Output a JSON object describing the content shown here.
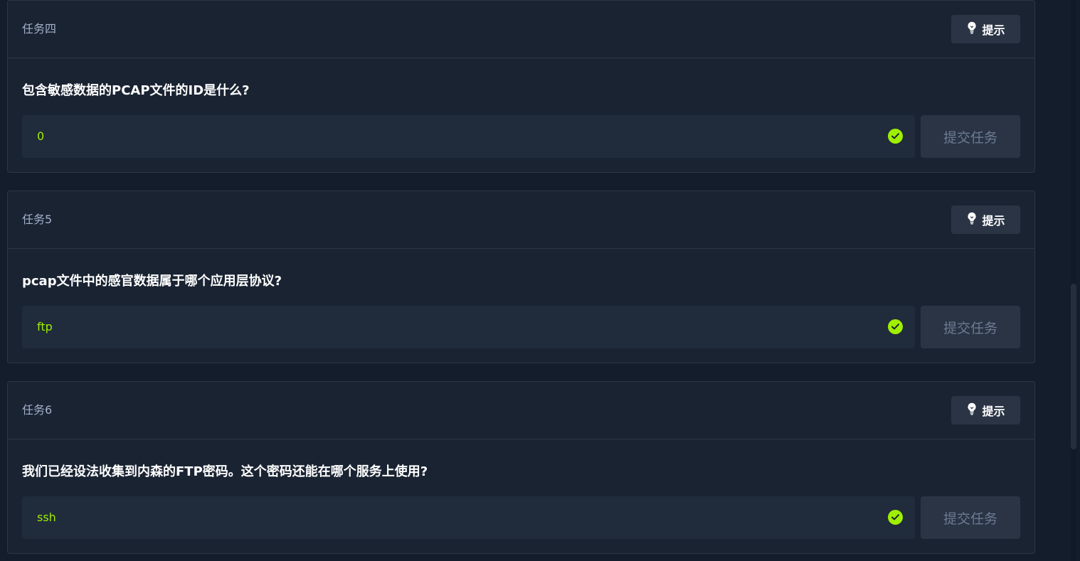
{
  "tasks": [
    {
      "title": "任务四",
      "hint_label": "提示",
      "question": "包含敏感数据的PCAP文件的ID是什么?",
      "answer": "0",
      "submit_label": "提交任务"
    },
    {
      "title": "任务5",
      "hint_label": "提示",
      "question": "pcap文件中的感官数据属于哪个应用层协议?",
      "answer": "ftp",
      "submit_label": "提交任务"
    },
    {
      "title": "任务6",
      "hint_label": "提示",
      "question": "我们已经设法收集到内森的FTP密码。这个密码还能在哪个服务上使用?",
      "answer": "ssh",
      "submit_label": "提交任务"
    }
  ],
  "colors": {
    "accent": "#9fef00",
    "background": "#141d2b",
    "card": "#1a2332",
    "input": "#202b3c",
    "button": "#2a3445"
  },
  "icons": {
    "hint": "lightbulb-icon",
    "status": "check-circle-icon"
  }
}
